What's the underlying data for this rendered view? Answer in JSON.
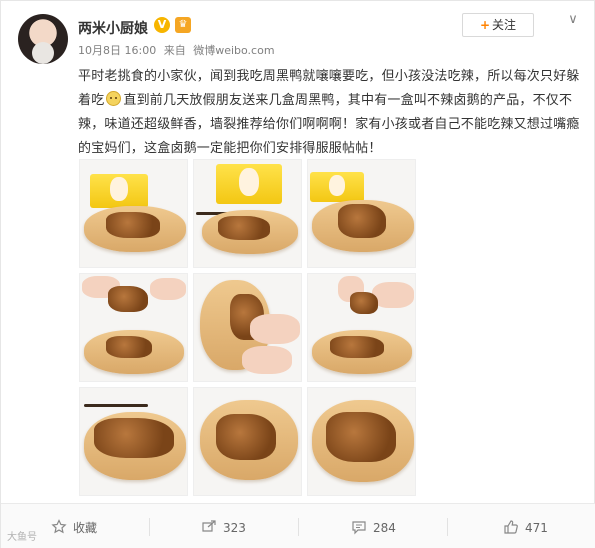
{
  "user": {
    "name": "两米小厨娘",
    "verified_badge": "V",
    "follow_label": "关注",
    "follow_plus": "+"
  },
  "meta": {
    "date": "10月8日 16:00",
    "source_prefix": "来自",
    "source": "微博weibo.com"
  },
  "post": {
    "text_before_emoji": "平时老挑食的小家伙，闻到我吃周黑鸭就嚷嚷要吃，但小孩没法吃辣，所以每次只好躲着吃",
    "emoji_name": "cute-face-emoji",
    "text_after_emoji": "直到前几天放假朋友送来几盒周黑鸭，其中有一盒叫不辣卤鹅的产品，不仅不辣，味道还超级鲜香，墙裂推荐给你们啊啊啊！家有小孩或者自己不能吃辣又想过嘴瘾的宝妈们，这盒卤鹅一定能把你们安排得服服帖帖！"
  },
  "photos": [
    {
      "name": "photo-1",
      "desc": "package-and-plate"
    },
    {
      "name": "photo-2",
      "desc": "package-and-plate"
    },
    {
      "name": "photo-3",
      "desc": "package-and-plate"
    },
    {
      "name": "photo-4",
      "desc": "hands-tearing-goose"
    },
    {
      "name": "photo-5",
      "desc": "hand-holding-piece"
    },
    {
      "name": "photo-6",
      "desc": "hands-tearing-goose"
    },
    {
      "name": "photo-7",
      "desc": "plate-with-chopsticks"
    },
    {
      "name": "photo-8",
      "desc": "plate-closeup"
    },
    {
      "name": "photo-9",
      "desc": "plate-closeup"
    }
  ],
  "actions": {
    "favorite_label": "收藏",
    "repost_count": "323",
    "comment_count": "284",
    "like_count": "471"
  },
  "watermark_text": "大鱼号"
}
